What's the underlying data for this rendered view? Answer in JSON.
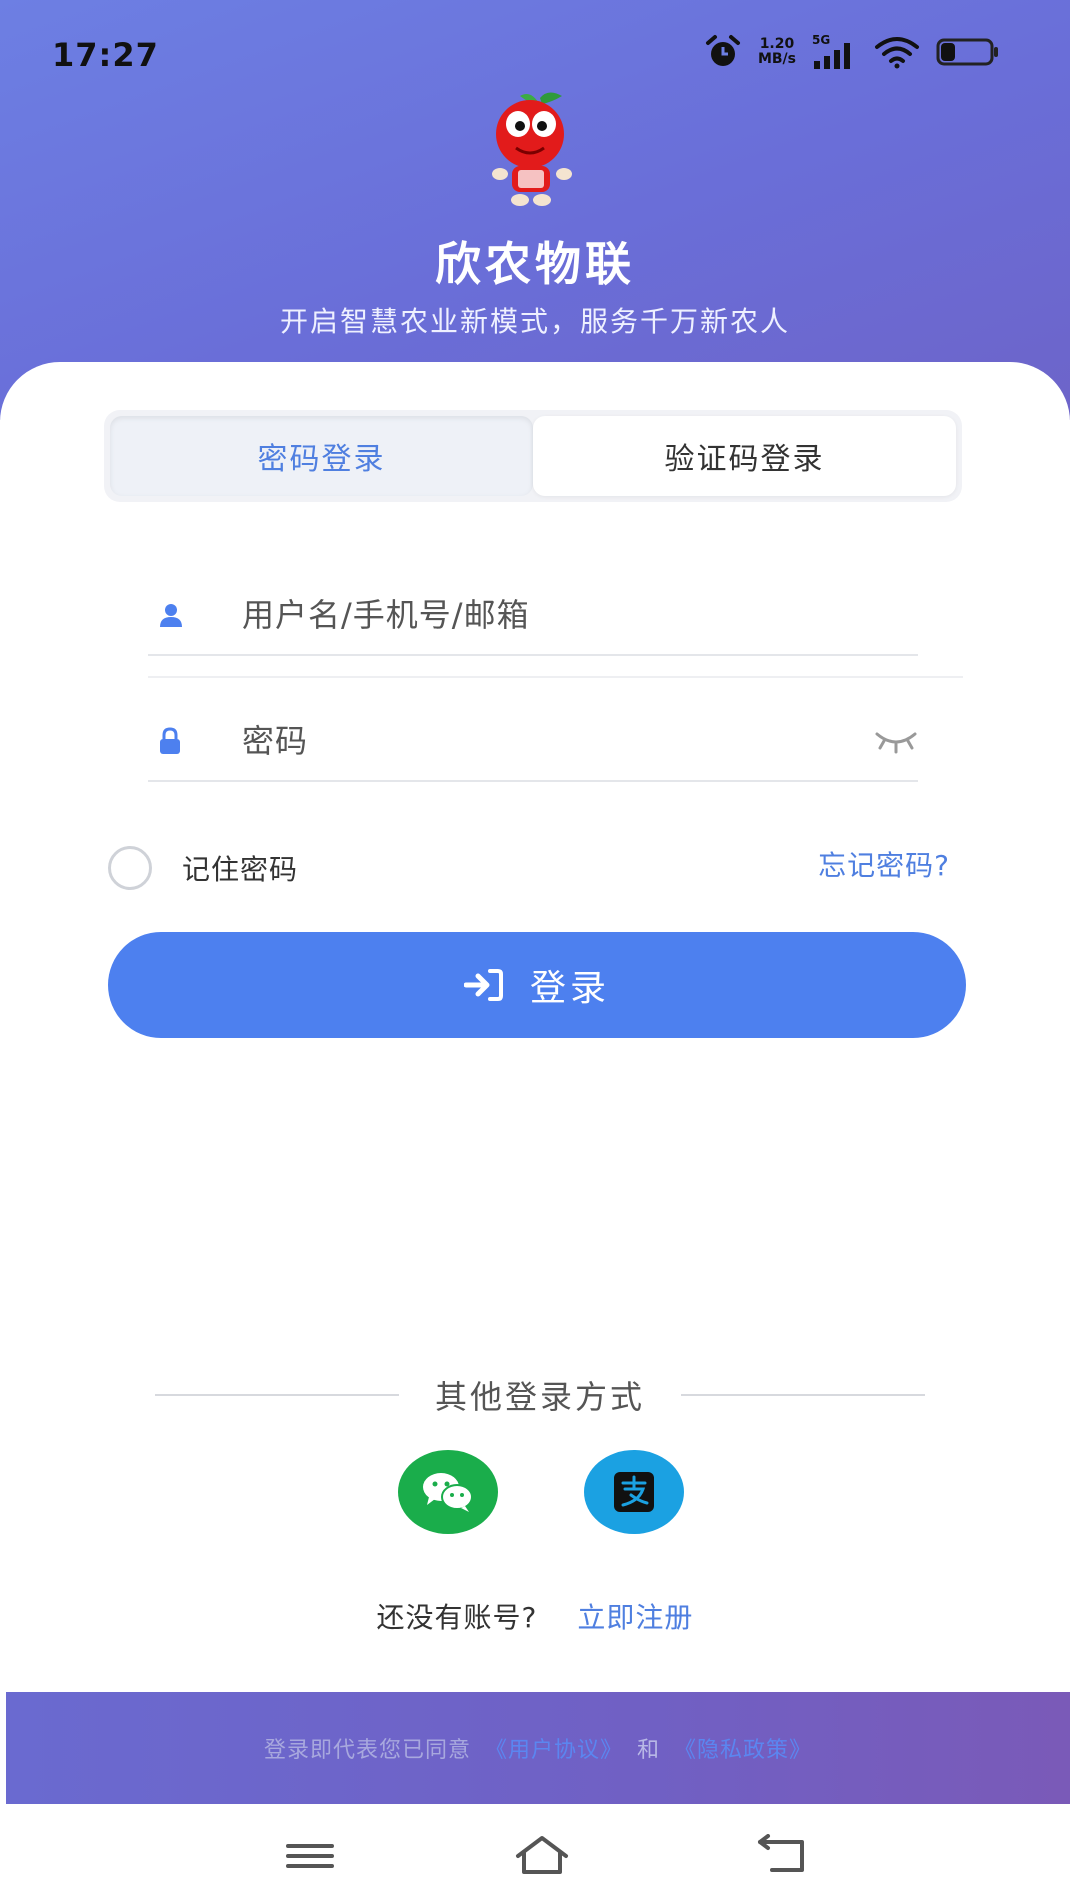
{
  "status_bar": {
    "time": "17:27",
    "speed_value": "1.20",
    "speed_unit": "MB/s",
    "network": "5G"
  },
  "header": {
    "app_name": "欣农物联",
    "slogan": "开启智慧农业新模式，服务千万新农人"
  },
  "tabs": [
    {
      "label": "密码登录",
      "active": true
    },
    {
      "label": "验证码登录",
      "active": false
    }
  ],
  "form": {
    "username_placeholder": "用户名/手机号/邮箱",
    "username_value": "",
    "password_placeholder": "密码",
    "password_value": "",
    "remember_label": "记住密码",
    "remember_checked": false,
    "forgot_label": "忘记密码?",
    "login_label": "登录"
  },
  "other_login": {
    "title": "其他登录方式",
    "methods": [
      "wechat-icon",
      "alipay-icon"
    ]
  },
  "register": {
    "question": "还没有账号?",
    "link": "立即注册"
  },
  "agreement": {
    "prefix": "登录即代表您已同意",
    "user_agreement": "《用户协议》",
    "and": "和",
    "privacy_policy": "《隐私政策》"
  },
  "colors": {
    "primary": "#4d80ef",
    "header_gradient_start": "#6d7fe3",
    "header_gradient_end": "#6d64c9",
    "wechat": "#1aad4b",
    "alipay": "#1ba1e2"
  }
}
